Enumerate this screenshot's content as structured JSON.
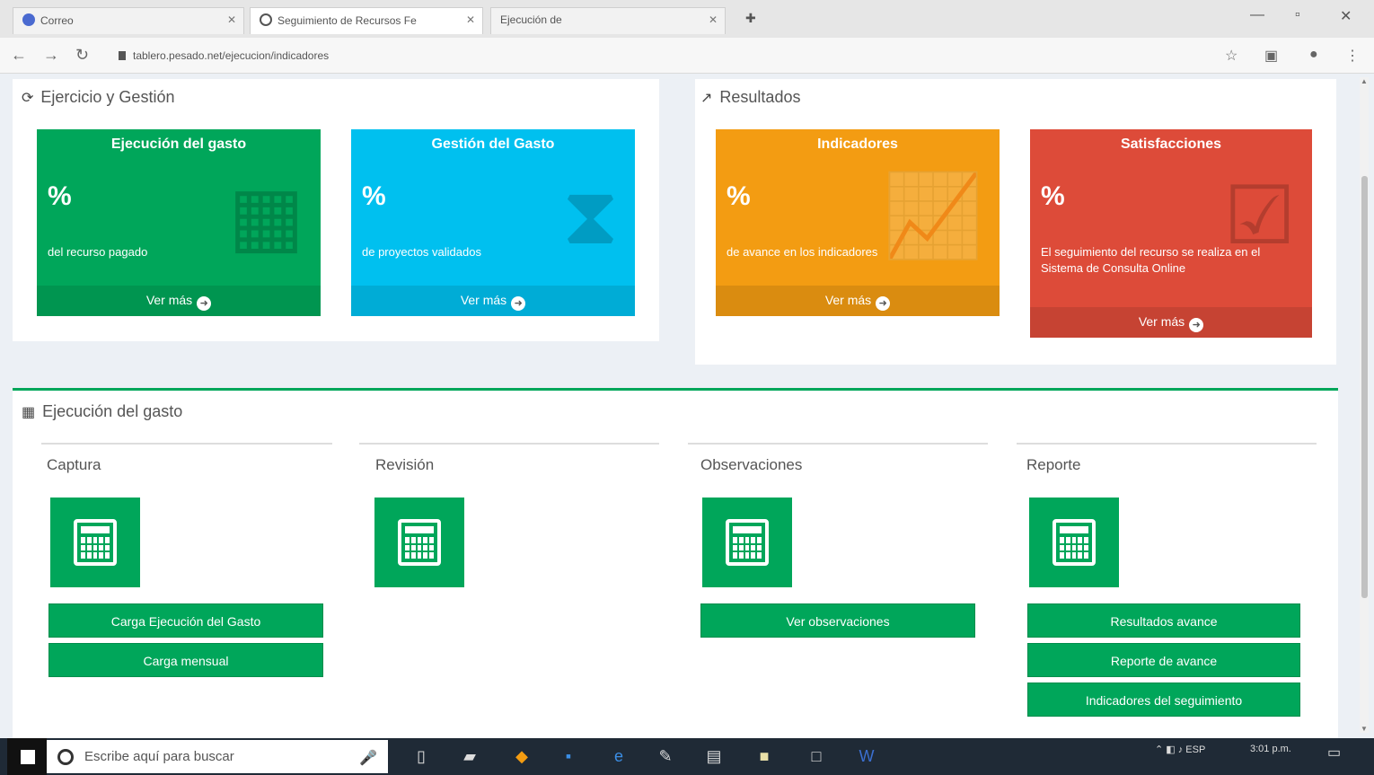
{
  "browser": {
    "tabs": [
      {
        "label": "Correo"
      },
      {
        "label": "Seguimiento de Recursos Fe"
      },
      {
        "label": "Ejecución de"
      }
    ],
    "url": "tablero.pesado.net/ejecucion/indicadores"
  },
  "top_left_panel": {
    "title": "Ejercicio y Gestión",
    "boxes": [
      {
        "title": "Ejecución del gasto",
        "value": "%",
        "desc": "del recurso pagado",
        "footer": "Ver más"
      },
      {
        "title": "Gestión del Gasto",
        "value": "%",
        "desc": "de proyectos validados",
        "footer": "Ver más"
      }
    ]
  },
  "top_right_panel": {
    "title": "Resultados",
    "boxes": [
      {
        "title": "Indicadores",
        "value": "%",
        "desc": "de avance en los indicadores",
        "footer": "Ver más"
      },
      {
        "title": "Satisfacciones",
        "value": "%",
        "desc": "El seguimiento del recurso se realiza en el Sistema de Consulta Online",
        "footer": "Ver más"
      }
    ]
  },
  "bottom_panel": {
    "title": "Ejecución del gasto",
    "columns": [
      {
        "title": "Captura",
        "buttons": [
          "Carga Ejecución del Gasto",
          "Carga mensual"
        ]
      },
      {
        "title": "Revisión",
        "buttons": []
      },
      {
        "title": "Observaciones",
        "buttons": [
          "Ver observaciones"
        ]
      },
      {
        "title": "Reporte",
        "buttons": [
          "Resultados avance",
          "Reporte de avance",
          "Indicadores del seguimiento"
        ]
      }
    ]
  },
  "taskbar": {
    "search_placeholder": "Escribe aquí para buscar",
    "time": "3:01 p.m.",
    "lang": "ESP"
  },
  "colors": {
    "green": "#00a65a",
    "aqua": "#00c0ef",
    "orange": "#f39c12",
    "red": "#dd4b39"
  }
}
